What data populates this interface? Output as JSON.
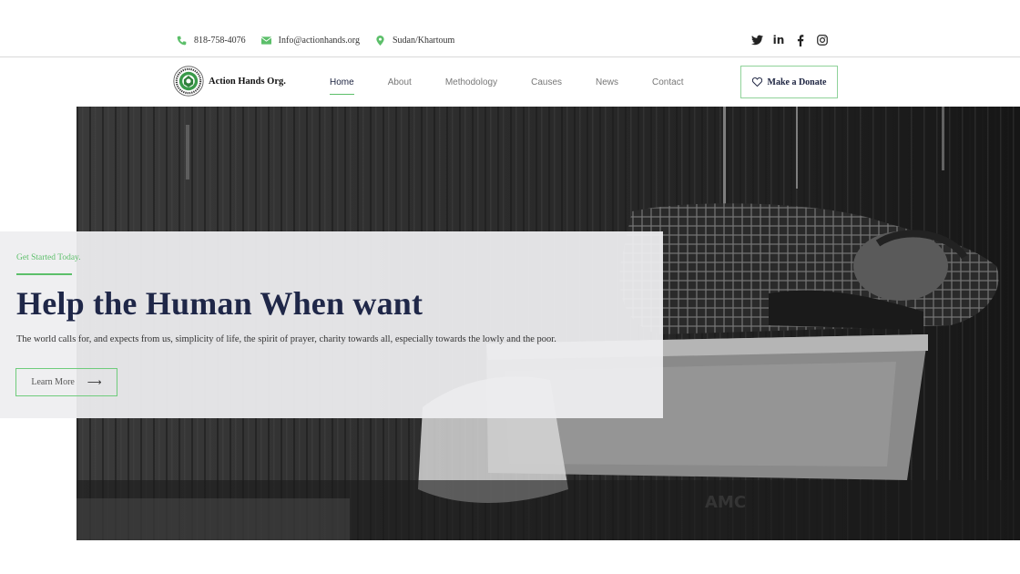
{
  "topbar": {
    "phone": "818-758-4076",
    "email": "Info@actionhands.org",
    "location": "Sudan/Khartoum",
    "icons": {
      "phone": "phone-icon",
      "email": "email-icon",
      "location": "location-pin-icon"
    },
    "social": [
      "twitter-icon",
      "linkedin-icon",
      "facebook-icon",
      "instagram-icon"
    ]
  },
  "brand": {
    "name": "Action Hands Org."
  },
  "nav": {
    "items": [
      {
        "label": "Home",
        "active": true
      },
      {
        "label": "About",
        "active": false
      },
      {
        "label": "Methodology",
        "active": false
      },
      {
        "label": "Causes",
        "active": false
      },
      {
        "label": "News",
        "active": false
      },
      {
        "label": "Contact",
        "active": false
      }
    ],
    "donate_label": "Make a Donate"
  },
  "hero": {
    "kicker": "Get Started Today.",
    "headline": "Help the Human When want",
    "text": "The world calls for, and expects from us, simplicity of life, the spirit of prayer, charity towards all, especially towards the lowly and the poor.",
    "cta_label": "Learn More",
    "photo_text": "AMC"
  },
  "colors": {
    "accent": "#5cbf6a",
    "heading": "#1f2748"
  }
}
